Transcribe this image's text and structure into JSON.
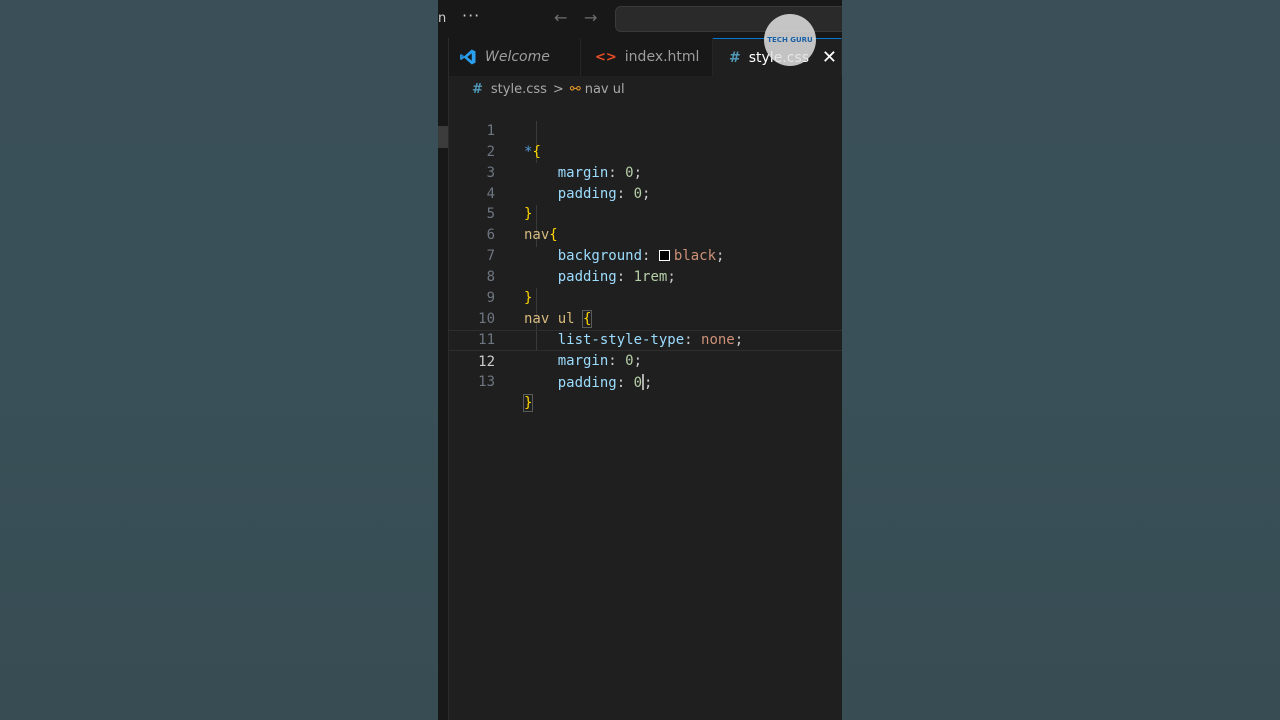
{
  "titlebar": {
    "menu_fragment": "n",
    "more": "···",
    "back": "←",
    "forward": "→"
  },
  "tabs": [
    {
      "label": "Welcome"
    },
    {
      "label": "index.html"
    },
    {
      "label": "style.css",
      "active": true
    }
  ],
  "watermark": {
    "text": "TECH GURU"
  },
  "breadcrumb": {
    "file": "style.css",
    "separator": ">",
    "symbol": "nav ul"
  },
  "code": {
    "active_line": 12,
    "lines": [
      {
        "n": "1"
      },
      {
        "n": "2"
      },
      {
        "n": "3"
      },
      {
        "n": "4"
      },
      {
        "n": "5"
      },
      {
        "n": "6"
      },
      {
        "n": "7"
      },
      {
        "n": "8"
      },
      {
        "n": "9"
      },
      {
        "n": "10"
      },
      {
        "n": "11"
      },
      {
        "n": "12"
      },
      {
        "n": "13"
      }
    ],
    "tokens": {
      "l1_sel": "*",
      "l1_brace": "{",
      "l2_prop": "margin",
      "l2_val": "0",
      "l3_prop": "padding",
      "l3_val": "0",
      "l4_brace": "}",
      "l5_sel": "nav",
      "l5_brace": "{",
      "l6_prop": "background",
      "l6_val": "black",
      "l7_prop": "padding",
      "l7_val": "1rem",
      "l8_brace": "}",
      "l9_sel": "nav ul ",
      "l9_brace": "{",
      "l10_prop": "list-style-type",
      "l10_val": "none",
      "l11_prop": "margin",
      "l11_val": "0",
      "l12_prop": "padding",
      "l12_val": "0",
      "l13_brace": "}"
    }
  },
  "colors": {
    "editor_bg": "#1f1f1f",
    "accent": "#0078d4",
    "property": "#9cdcfe",
    "selector": "#d7ba7d",
    "brace": "#ffd700",
    "number": "#b5cea8",
    "keyword": "#ce9178"
  }
}
